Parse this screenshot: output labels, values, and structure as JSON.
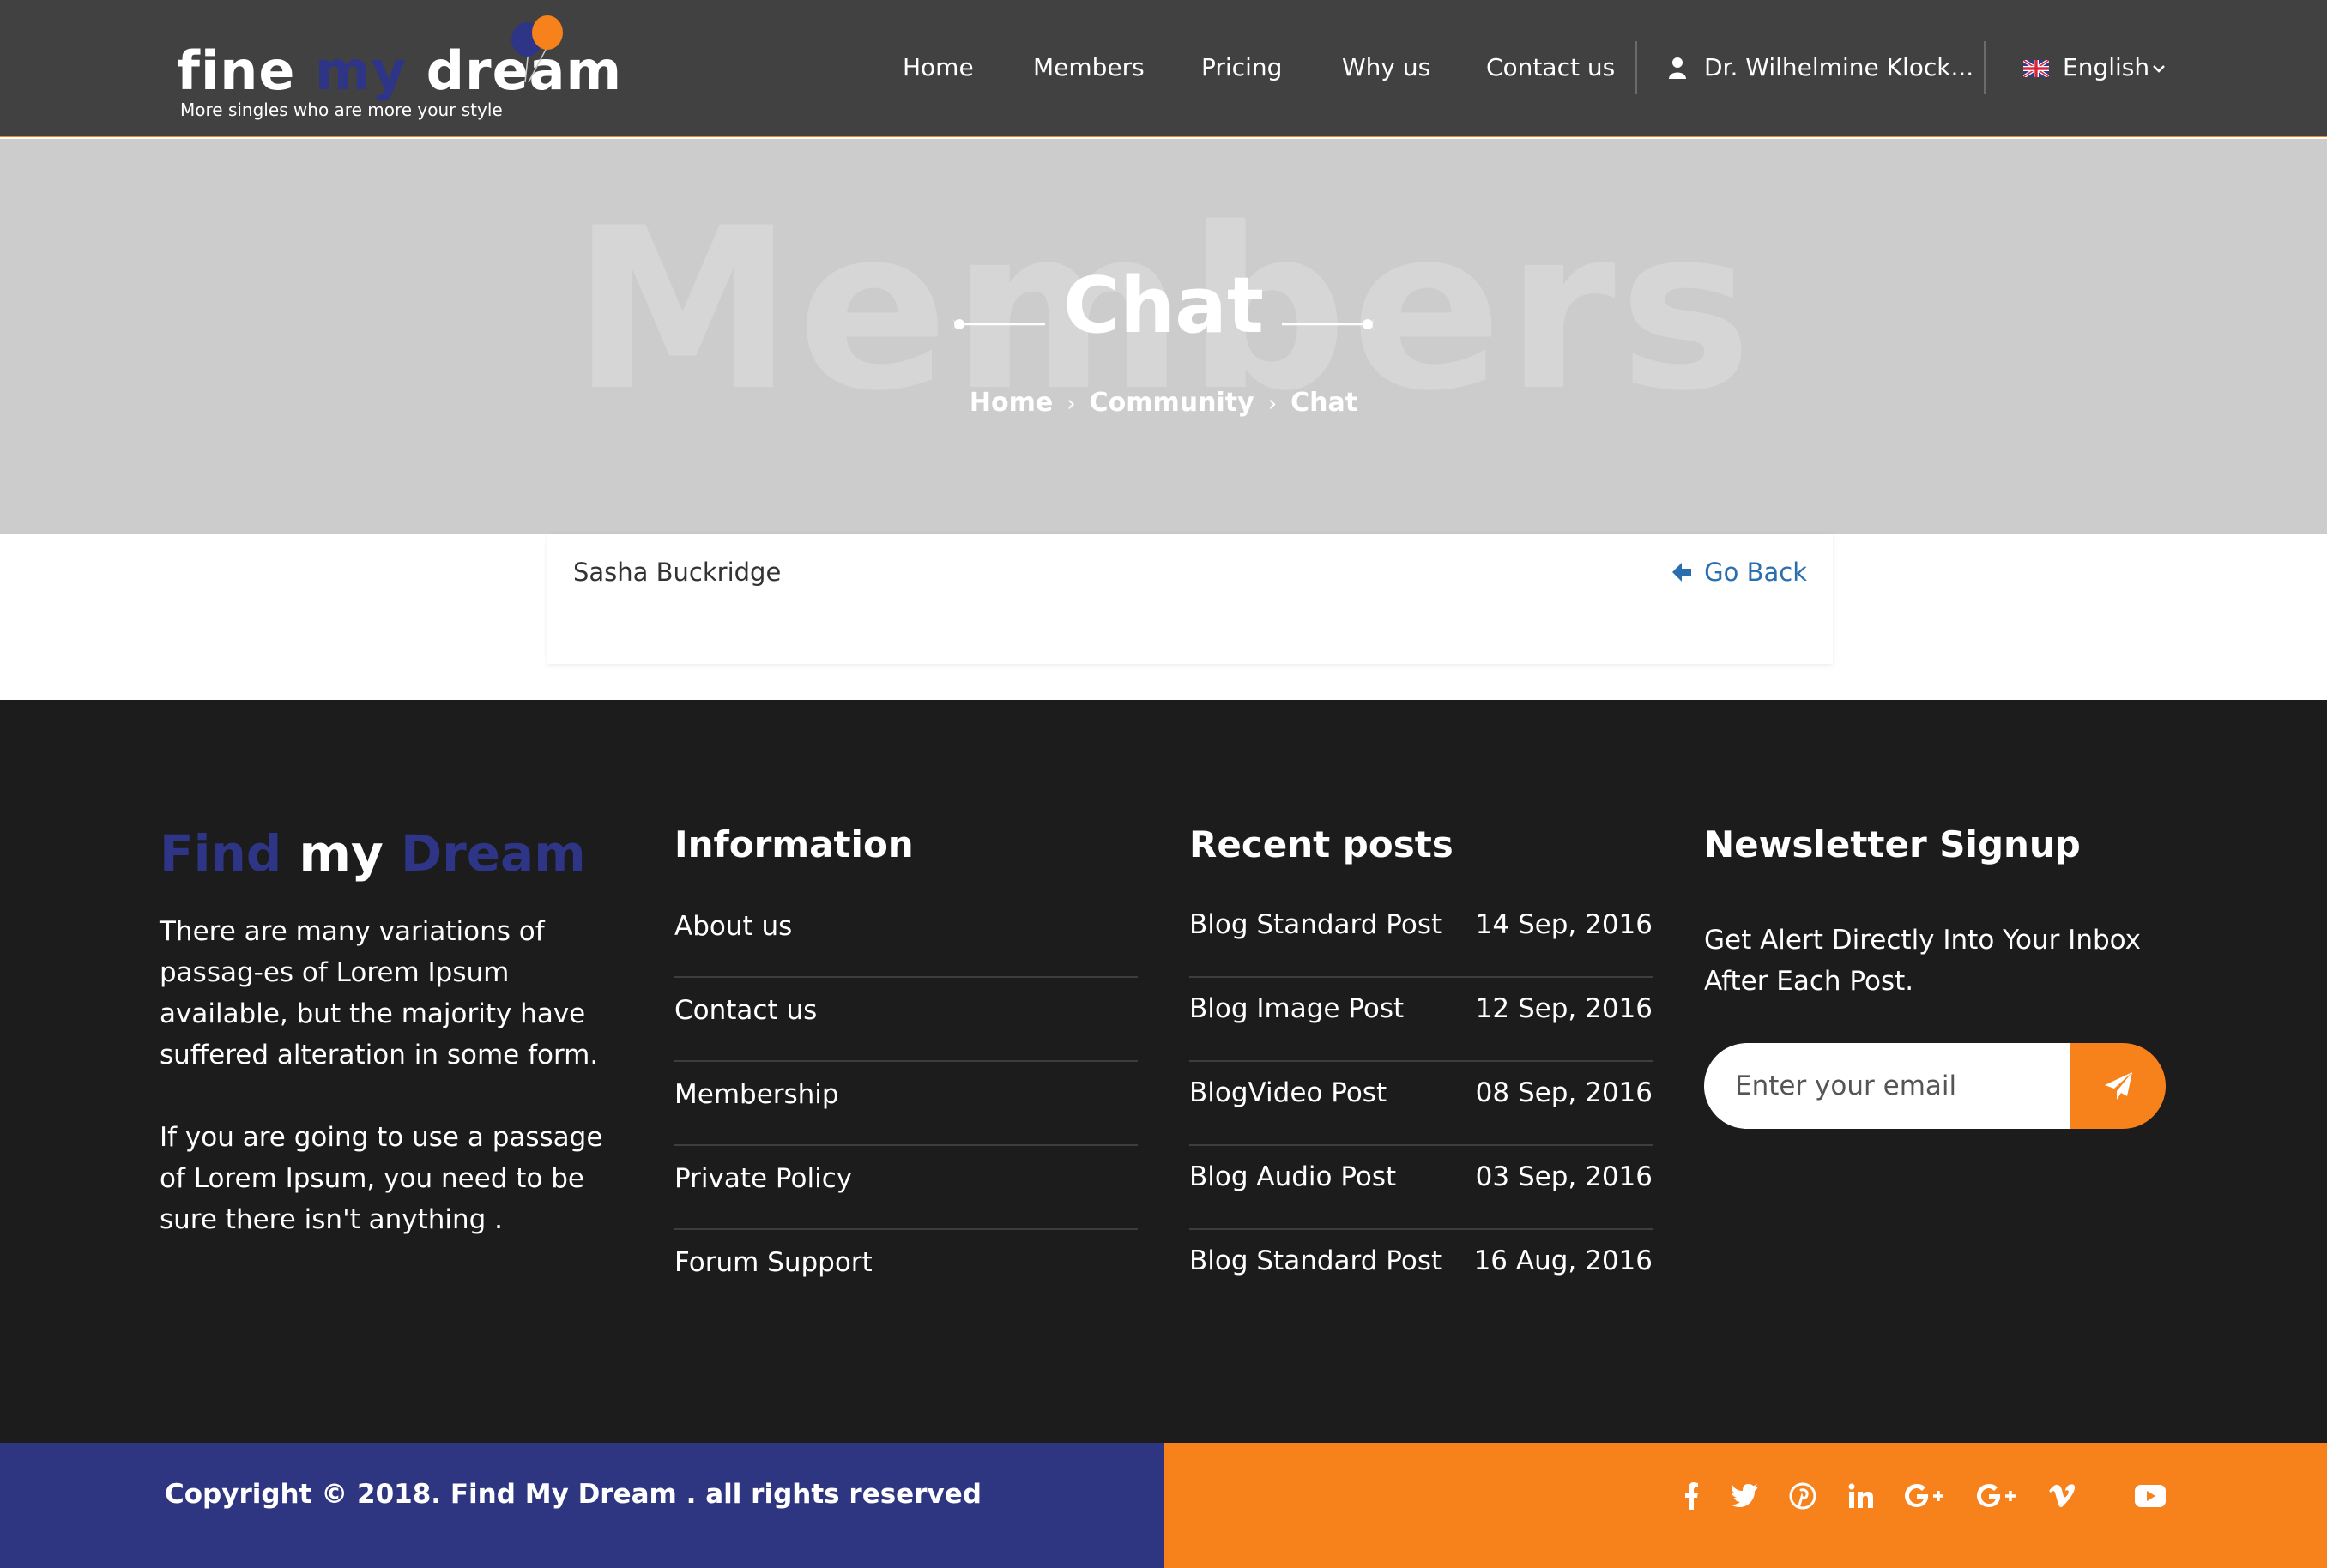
{
  "header": {
    "logo": {
      "word1": "fine",
      "word2": "my",
      "word3": "dream",
      "tagline": "More singles who are more your style"
    },
    "nav": [
      "Home",
      "Members",
      "Pricing",
      "Why us",
      "Contact us"
    ],
    "user_name": "Dr. Wilhelmine Klock...",
    "language": "English",
    "icons": {
      "user": "user-icon",
      "flag": "uk-flag-icon",
      "dropdown": "chevron-down-icon"
    }
  },
  "hero": {
    "background_text": "Members",
    "title": "Chat",
    "breadcrumb": [
      "Home",
      "Community",
      "Chat"
    ]
  },
  "chat": {
    "contact_name": "Sasha Buckridge",
    "go_back_label": "Go Back"
  },
  "footer": {
    "brand": {
      "find": "Find",
      "my": "my",
      "dream": "Dream"
    },
    "about_p1": "There are many variations of passag-es of Lorem Ipsum available, but the majority have suffered alteration in some form.",
    "about_p2": "If you are going to use a passage of Lorem Ipsum, you need to be sure there isn't anything .",
    "info_title": "Information",
    "info_links": [
      "About us",
      "Contact us",
      "Membership",
      "Private Policy",
      "Forum Support"
    ],
    "posts_title": "Recent posts",
    "posts": [
      {
        "title": "Blog Standard Post",
        "date": "14 Sep, 2016"
      },
      {
        "title": "Blog Image Post",
        "date": "12 Sep, 2016"
      },
      {
        "title": "BlogVideo Post",
        "date": "08 Sep, 2016"
      },
      {
        "title": "Blog Audio Post",
        "date": "03 Sep, 2016"
      },
      {
        "title": "Blog Standard Post",
        "date": "16 Aug, 2016"
      }
    ],
    "newsletter_title": "Newsletter Signup",
    "newsletter_text": "Get Alert Directly Into Your Inbox After Each Post.",
    "newsletter_placeholder": "Enter your email"
  },
  "bottom": {
    "copyright": "Copyright © 2018. Find My Dream . all rights reserved",
    "social": [
      "facebook-icon",
      "twitter-icon",
      "pinterest-icon",
      "linkedin-icon",
      "google-plus-icon",
      "google-plus-icon",
      "vimeo-icon",
      "youtube-icon"
    ]
  },
  "colors": {
    "header_bg": "#414141",
    "accent_orange": "#f7811b",
    "brand_blue": "#2e3586",
    "hero_bg": "#cccccc",
    "footer_bg": "#1c1c1c",
    "link_blue": "#2a6eb0"
  }
}
